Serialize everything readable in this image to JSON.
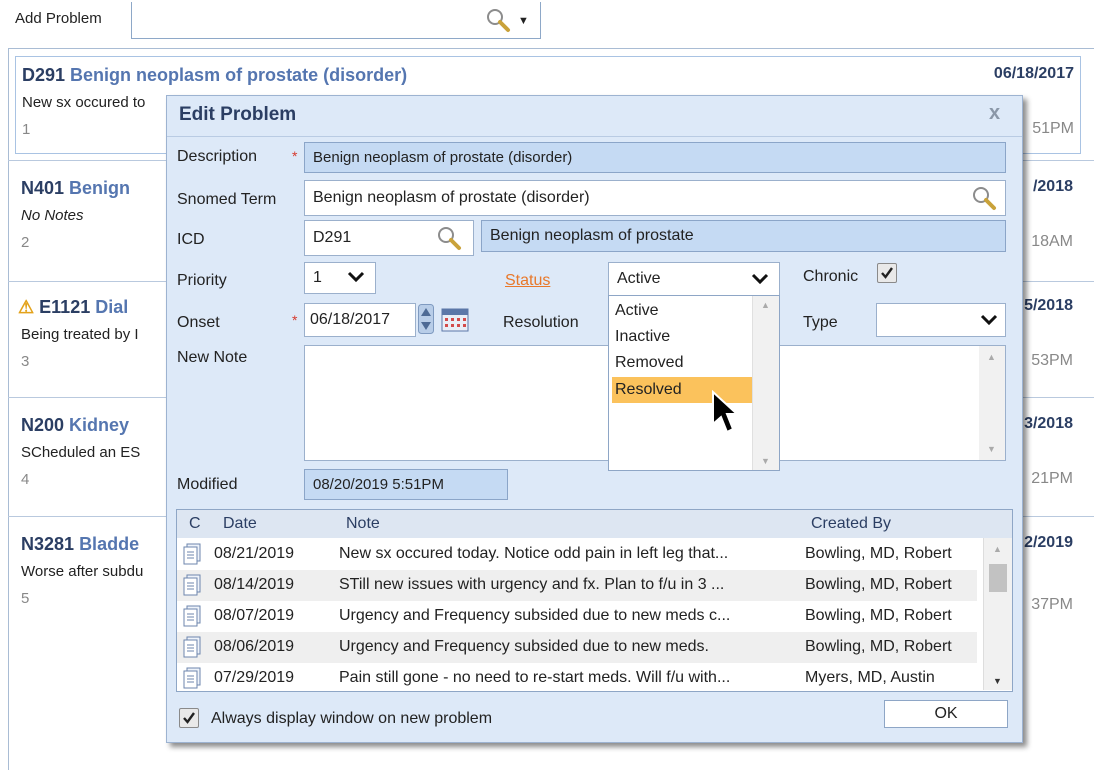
{
  "add_problem": {
    "label": "Add Problem",
    "value": ""
  },
  "problems": [
    {
      "code": "D291",
      "name": "Benign neoplasm of prostate (disorder)",
      "note": "New sx occured to",
      "index": "1",
      "date": "06/18/2017",
      "time": "51PM"
    },
    {
      "code": "N401",
      "name": "Benign",
      "note": "No Notes",
      "index": "2",
      "date": "/2018",
      "time": "18AM"
    },
    {
      "code": "E1121",
      "name": "Dial",
      "note": "Being treated by I",
      "index": "3",
      "date": "5/2018",
      "time": "53PM"
    },
    {
      "code": "N200",
      "name": "Kidney",
      "note": "SCheduled an ES",
      "index": "4",
      "date": "3/2018",
      "time": "21PM"
    },
    {
      "code": "N3281",
      "name": "Bladde",
      "note": "Worse after subdu",
      "index": "5",
      "date": "2/2019",
      "time": "37PM"
    }
  ],
  "dialog": {
    "title": "Edit Problem",
    "close": "x",
    "labels": {
      "description": "Description",
      "snomed": "Snomed Term",
      "icd": "ICD",
      "priority": "Priority",
      "status": "Status",
      "chronic": "Chronic",
      "onset": "Onset",
      "resolution": "Resolution",
      "type": "Type",
      "new_note": "New Note",
      "modified": "Modified"
    },
    "required_mark": "*",
    "description": "Benign neoplasm of prostate (disorder)",
    "snomed": "Benign neoplasm of prostate (disorder)",
    "icd_code": "D291",
    "icd_desc": "Benign neoplasm of prostate",
    "priority": "1",
    "status": "Active",
    "status_options": [
      "Active",
      "Inactive",
      "Removed",
      "Resolved"
    ],
    "status_highlighted": "Resolved",
    "chronic_checked": true,
    "onset": "06/18/2017",
    "type": "",
    "new_note": "",
    "modified": "08/20/2019  5:51PM",
    "table": {
      "headers": [
        "C",
        "Date",
        "Note",
        "Created By"
      ],
      "rows": [
        {
          "date": "08/21/2019",
          "note": "New sx occured today. Notice odd pain in left leg that...",
          "by": "Bowling, MD, Robert"
        },
        {
          "date": "08/14/2019",
          "note": "STill new issues with urgency and fx. Plan to f/u in 3 ...",
          "by": "Bowling, MD, Robert"
        },
        {
          "date": "08/07/2019",
          "note": "Urgency and Frequency subsided due to new meds c...",
          "by": "Bowling, MD, Robert"
        },
        {
          "date": "08/06/2019",
          "note": "Urgency and Frequency subsided due to new meds.",
          "by": "Bowling, MD, Robert"
        },
        {
          "date": "07/29/2019",
          "note": "Pain still gone - no need to re-start meds. Will f/u with...",
          "by": "Myers, MD, Austin"
        }
      ]
    },
    "always_display_checked": true,
    "always_display_label": "Always display window on new problem",
    "ok_label": "OK"
  },
  "colors": {
    "accent": "#2b3e63",
    "link": "#5576b0",
    "status_link": "#e8782a",
    "highlight": "#fbc25c",
    "readonly": "#c5daf3"
  }
}
